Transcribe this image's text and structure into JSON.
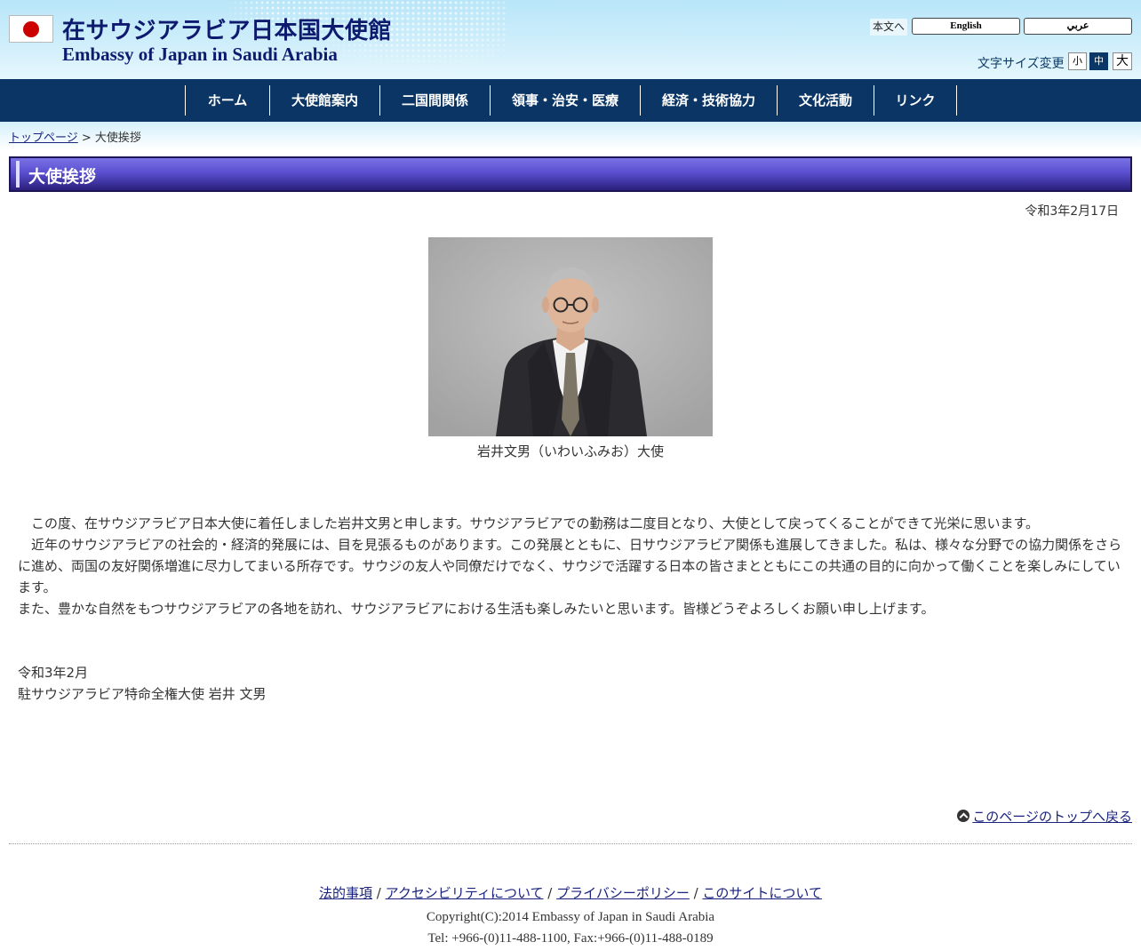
{
  "header": {
    "title_jp": "在サウジアラビア日本国大使館",
    "title_en": "Embassy of Japan in Saudi Arabia",
    "skip_link": "本文へ",
    "lang_en": "English",
    "lang_ar": "عربي",
    "font_size_label": "文字サイズ変更",
    "font_size_small": "小",
    "font_size_medium": "中",
    "font_size_large": "大"
  },
  "nav": {
    "items": [
      {
        "label": "ホーム"
      },
      {
        "label": "大使館案内"
      },
      {
        "label": "二国間関係"
      },
      {
        "label": "領事・治安・医療"
      },
      {
        "label": "経済・技術協力"
      },
      {
        "label": "文化活動"
      },
      {
        "label": "リンク"
      }
    ]
  },
  "breadcrumb": {
    "home": "トップページ",
    "separator": " > ",
    "current": "大使挨拶"
  },
  "page": {
    "heading": "大使挨拶",
    "date": "令和3年2月17日",
    "photo_caption": "岩井文男（いわいふみお）大使",
    "paragraphs": [
      "　この度、在サウジアラビア日本大使に着任しました岩井文男と申します。サウジアラビアでの勤務は二度目となり、大使として戻ってくることができて光栄に思います。",
      "　近年のサウジアラビアの社会的・経済的発展には、目を見張るものがあります。この発展とともに、日サウジアラビア関係も進展してきました。私は、様々な分野での協力関係をさらに進め、両国の友好関係増進に尽力してまいる所存です。サウジの友人や同僚だけでなく、サウジで活躍する日本の皆さまとともにこの共通の目的に向かって働くことを楽しみにしています。",
      "また、豊かな自然をもつサウジアラビアの各地を訪れ、サウジアラビアにおける生活も楽しみたいと思います。皆様どうぞよろしくお願い申し上げます。"
    ],
    "signature_date": "令和3年2月",
    "signature_name": "駐サウジアラビア特命全権大使 岩井 文男",
    "back_to_top": "このページのトップへ戻る"
  },
  "footer": {
    "links": [
      {
        "label": "法的事項"
      },
      {
        "label": "アクセシビリティについて"
      },
      {
        "label": "プライバシーポリシー"
      },
      {
        "label": "このサイトについて"
      }
    ],
    "link_separator": " / ",
    "copyright": "Copyright(C):2014 Embassy of Japan in Saudi Arabia",
    "tel": "Tel: +966-(0)11-488-1100, Fax:+966-(0)11-488-0189"
  }
}
